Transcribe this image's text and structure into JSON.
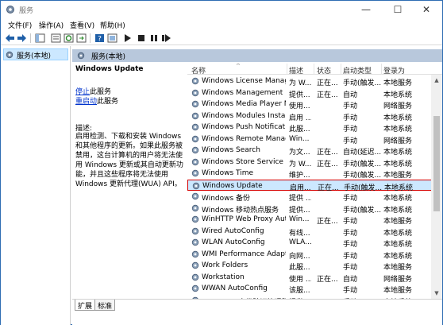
{
  "window": {
    "title": "服务",
    "btn_min": "—",
    "btn_max": "☐",
    "btn_close": "✕"
  },
  "menu": [
    "文件(F)",
    "操作(A)",
    "查看(V)",
    "帮助(H)"
  ],
  "toolbar_icons": [
    "back-icon",
    "forward-icon",
    "console-tree-icon",
    "properties-icon",
    "refresh-icon",
    "export-icon",
    "help-icon",
    "view-icon",
    "start-icon",
    "stop-icon",
    "pause-icon",
    "restart-icon"
  ],
  "tree": {
    "label": "服务(本地)"
  },
  "pane": {
    "header": "服务(本地)"
  },
  "details": {
    "title": "Windows Update",
    "link_stop": "停止",
    "link_stop_suffix": "此服务",
    "link_restart": "重启动",
    "link_restart_suffix": "此服务",
    "desc_label": "描述:",
    "desc_text": "启用检测、下载和安装 Windows 和其他程序的更新。如果此服务被禁用，这台计算机的用户将无法使用 Windows 更新或其自动更新功能，并且这些程序将无法使用 Windows 更新代理(WUA) API。"
  },
  "columns": {
    "name": "名称",
    "desc": "描述",
    "status": "状态",
    "startup": "启动类型",
    "logon": "登录为"
  },
  "rows": [
    {
      "name": "Windows License Manag...",
      "desc": "为 W...",
      "status": "正在...",
      "startup": "手动(触发...",
      "logon": "本地服务"
    },
    {
      "name": "Windows Management I...",
      "desc": "提供...",
      "status": "正在...",
      "startup": "自动",
      "logon": "本地系统"
    },
    {
      "name": "Windows Media Player N...",
      "desc": "使用...",
      "status": "",
      "startup": "手动",
      "logon": "网络服务"
    },
    {
      "name": "Windows Modules Install...",
      "desc": "启用 ...",
      "status": "",
      "startup": "手动",
      "logon": "本地系统"
    },
    {
      "name": "Windows Push Notificati...",
      "desc": "此服...",
      "status": "",
      "startup": "手动",
      "logon": "本地系统"
    },
    {
      "name": "Windows Remote Manag...",
      "desc": "Win...",
      "status": "",
      "startup": "手动",
      "logon": "网络服务"
    },
    {
      "name": "Windows Search",
      "desc": "为文...",
      "status": "正在...",
      "startup": "自动(延迟...",
      "logon": "本地系统"
    },
    {
      "name": "Windows Store Service (...",
      "desc": "为 W...",
      "status": "正在...",
      "startup": "手动(触发...",
      "logon": "本地系统"
    },
    {
      "name": "Windows Time",
      "desc": "维护...",
      "status": "",
      "startup": "手动(触发...",
      "logon": "本地服务"
    },
    {
      "name": "Windows Update",
      "desc": "启用...",
      "status": "正在...",
      "startup": "手动(触发...",
      "logon": "本地系统",
      "selected": true
    },
    {
      "name": "Windows 备份",
      "desc": "提供 ...",
      "status": "",
      "startup": "手动",
      "logon": "本地系统"
    },
    {
      "name": "Windows 移动热点服务",
      "desc": "提供...",
      "status": "",
      "startup": "手动(触发...",
      "logon": "本地系统"
    },
    {
      "name": "WinHTTP Web Proxy Aut...",
      "desc": "Win...",
      "status": "正在...",
      "startup": "手动",
      "logon": "本地服务"
    },
    {
      "name": "Wired AutoConfig",
      "desc": "有线...",
      "status": "",
      "startup": "手动",
      "logon": "本地系统"
    },
    {
      "name": "WLAN AutoConfig",
      "desc": "WLA...",
      "status": "",
      "startup": "手动",
      "logon": "本地系统"
    },
    {
      "name": "WMI Performance Adapt...",
      "desc": "向网...",
      "status": "",
      "startup": "手动",
      "logon": "本地系统"
    },
    {
      "name": "Work Folders",
      "desc": "此服...",
      "status": "",
      "startup": "手动",
      "logon": "本地服务"
    },
    {
      "name": "Workstation",
      "desc": "使用 ...",
      "status": "正在...",
      "startup": "自动",
      "logon": "网络服务"
    },
    {
      "name": "WWAN AutoConfig",
      "desc": "该服...",
      "status": "",
      "startup": "手动",
      "logon": "本地服务"
    },
    {
      "name": "Xbox Live 身份验证管理器",
      "desc": "提供...",
      "status": "",
      "startup": "手动",
      "logon": "本地系统"
    }
  ],
  "tabs": [
    "扩展",
    "标准"
  ],
  "colors": {
    "selection": "#cce8ff",
    "highlight_border": "#d40000",
    "header_band": "#b8c8dc"
  }
}
